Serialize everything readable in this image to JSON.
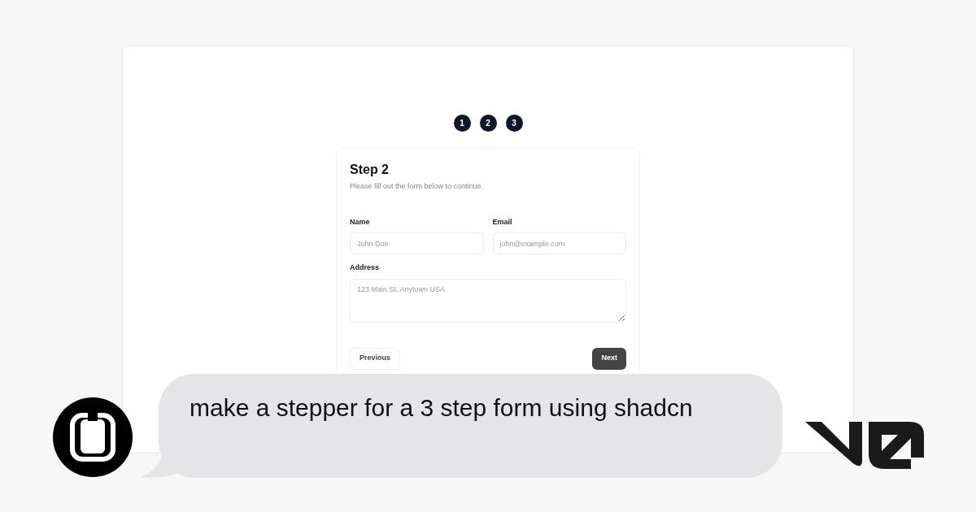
{
  "preview": {
    "steps": [
      {
        "label": "1"
      },
      {
        "label": "2"
      },
      {
        "label": "3"
      }
    ],
    "card": {
      "title": "Step 2",
      "description": "Please fill out the form below to continue.",
      "fields": [
        {
          "kind": "input",
          "label": "Name",
          "placeholder": "John Doe"
        },
        {
          "kind": "input",
          "label": "Email",
          "placeholder": "john@example.com"
        },
        {
          "kind": "textarea",
          "label": "Address",
          "placeholder": "123 Main St, Anytown USA"
        }
      ],
      "buttons": [
        {
          "kind": "outline",
          "label": "Previous"
        },
        {
          "kind": "primary",
          "label": "Next"
        }
      ]
    }
  },
  "prompt": {
    "text": "make a stepper for a 3 step form using shadcn"
  }
}
